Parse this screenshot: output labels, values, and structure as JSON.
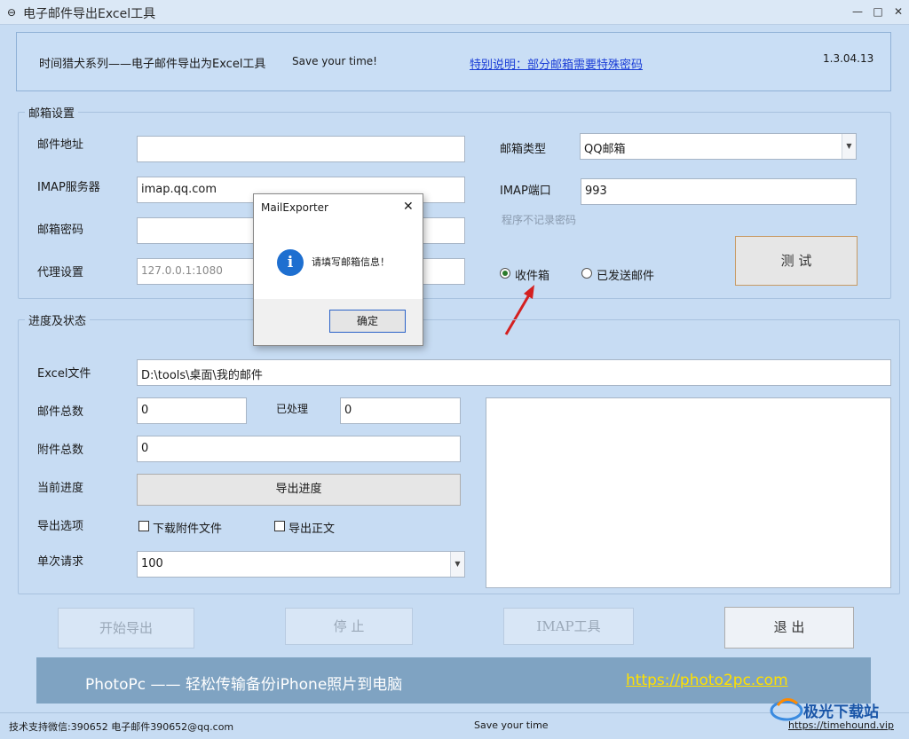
{
  "window": {
    "title": "电子邮件导出Excel工具",
    "minimize": "—",
    "maximize": "□",
    "close": "✕"
  },
  "header": {
    "app_name": "时间猎犬系列——电子邮件导出为Excel工具",
    "slogan": "Save your time!",
    "notice_link": "特别说明：部分邮箱需要特殊密码",
    "version": "1.3.04.13"
  },
  "mailbox": {
    "group_label": "邮箱设置",
    "email_label": "邮件地址",
    "email_value": "",
    "imap_server_label": "IMAP服务器",
    "imap_server_value": "imap.qq.com",
    "password_label": "邮箱密码",
    "password_value": "",
    "proxy_label": "代理设置",
    "proxy_value": "127.0.0.1:1080",
    "type_label": "邮箱类型",
    "type_value": "QQ邮箱",
    "port_label": "IMAP端口",
    "port_value": "993",
    "no_save_note": "程序不记录密码",
    "test_button": "测 试",
    "radio_inbox": "收件箱",
    "radio_sent": "已发送邮件"
  },
  "progress": {
    "group_label": "进度及状态",
    "excel_label": "Excel文件",
    "excel_value": "D:\\tools\\桌面\\我的邮件",
    "total_label": "邮件总数",
    "total_value": "0",
    "processed_label": "已处理",
    "processed_value": "0",
    "attach_label": "附件总数",
    "attach_value": "0",
    "current_label": "当前进度",
    "progress_button": "导出进度",
    "options_label": "导出选项",
    "opt_download_attach": "下载附件文件",
    "opt_export_body": "导出正文",
    "batch_label": "单次请求",
    "batch_value": "100"
  },
  "actions": {
    "start": "开始导出",
    "stop": "停 止",
    "imap_tool": "IMAP工具",
    "exit": "退 出"
  },
  "banner": {
    "text": "PhotoPc —— 轻松传输备份iPhone照片到电脑",
    "link": "https://photo2pc.com"
  },
  "status": {
    "support": "技术支持微信:390652  电子邮件390652@qq.com",
    "center": "Save your time",
    "site": "https://timehound.vip",
    "watermark": "极光下载站"
  },
  "dialog": {
    "title": "MailExporter",
    "close": "✕",
    "icon": "i",
    "message": "请填写邮箱信息！",
    "ok": "确定"
  },
  "colors": {
    "window_bg": "#c7dcf3",
    "link": "#1a3dd6",
    "banner_link": "#ffe000",
    "arrow": "#d42020"
  }
}
